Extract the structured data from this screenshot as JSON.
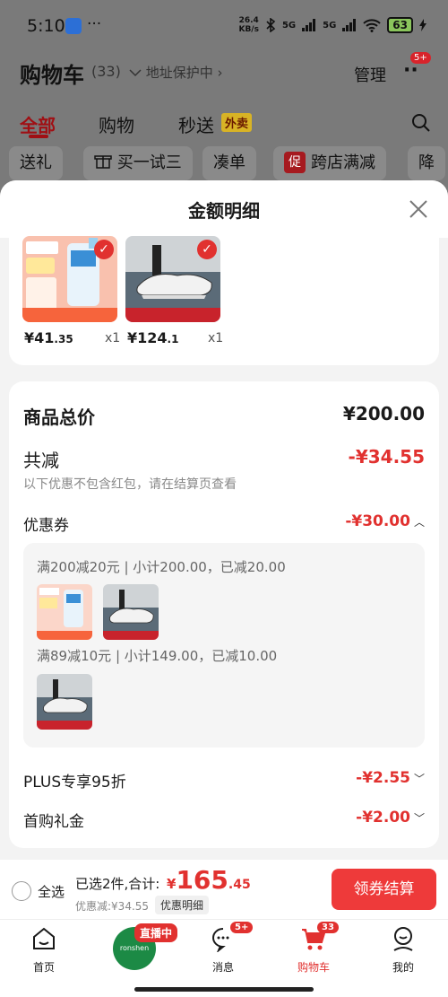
{
  "status_bar": {
    "time": "5:10",
    "more": "···",
    "net_speed_value": "26.4",
    "net_speed_unit": "KB/s",
    "signal1": "5G",
    "signal2": "5G",
    "battery": "63"
  },
  "header": {
    "title": "购物车",
    "count": "(33)",
    "address_protect": "地址保护中 ›",
    "manage": "管理",
    "more_badge": "5+"
  },
  "tabs": [
    {
      "label": "全部",
      "active": true
    },
    {
      "label": "购物"
    },
    {
      "label": "秒送"
    }
  ],
  "tab_badge": "外卖",
  "chips": [
    "送礼",
    "买一试三",
    "凑单",
    "跨店满减",
    "降"
  ],
  "chip_promo_icon": "促",
  "sheet": {
    "title": "金额明细",
    "products": [
      {
        "price_int": "¥41",
        "price_dec": ".35",
        "qty": "x1"
      },
      {
        "price_int": "¥124",
        "price_dec": ".1",
        "qty": "x1"
      }
    ],
    "summary": {
      "total_label": "商品总价",
      "total_value": "¥200.00",
      "reduce_label": "共减",
      "reduce_value": "-¥34.55",
      "reduce_hint": "以下优惠不包含红包，请在结算页查看",
      "coupon_label": "优惠券",
      "coupon_value": "-¥30.00",
      "coupon_line1": "满200减20元 | 小计200.00，已减20.00",
      "coupon_line2": "满89减10元 | 小计149.00，已减10.00",
      "plus_label": "PLUS专享95折",
      "plus_value": "-¥2.55",
      "first_label": "首购礼金",
      "first_value": "-¥2.00"
    }
  },
  "checkout": {
    "select_all": "全选",
    "selected_info": "已选2件,合计:",
    "total_symbol": "¥",
    "total_int": "165",
    "total_dec": ".45",
    "discount_info": "优惠减:¥34.55",
    "detail_btn": "优惠明细",
    "checkout_btn": "领券结算"
  },
  "nav": {
    "home": "首页",
    "live_badge": "直播中",
    "live_logo": "ronshen",
    "messages": "消息",
    "messages_badge": "5+",
    "cart": "购物车",
    "cart_badge": "33",
    "me": "我的"
  },
  "colors": {
    "accent_red": "#e1312f",
    "checkout_red": "#ee3a3a",
    "dark_red_tab": "#a00f14"
  }
}
